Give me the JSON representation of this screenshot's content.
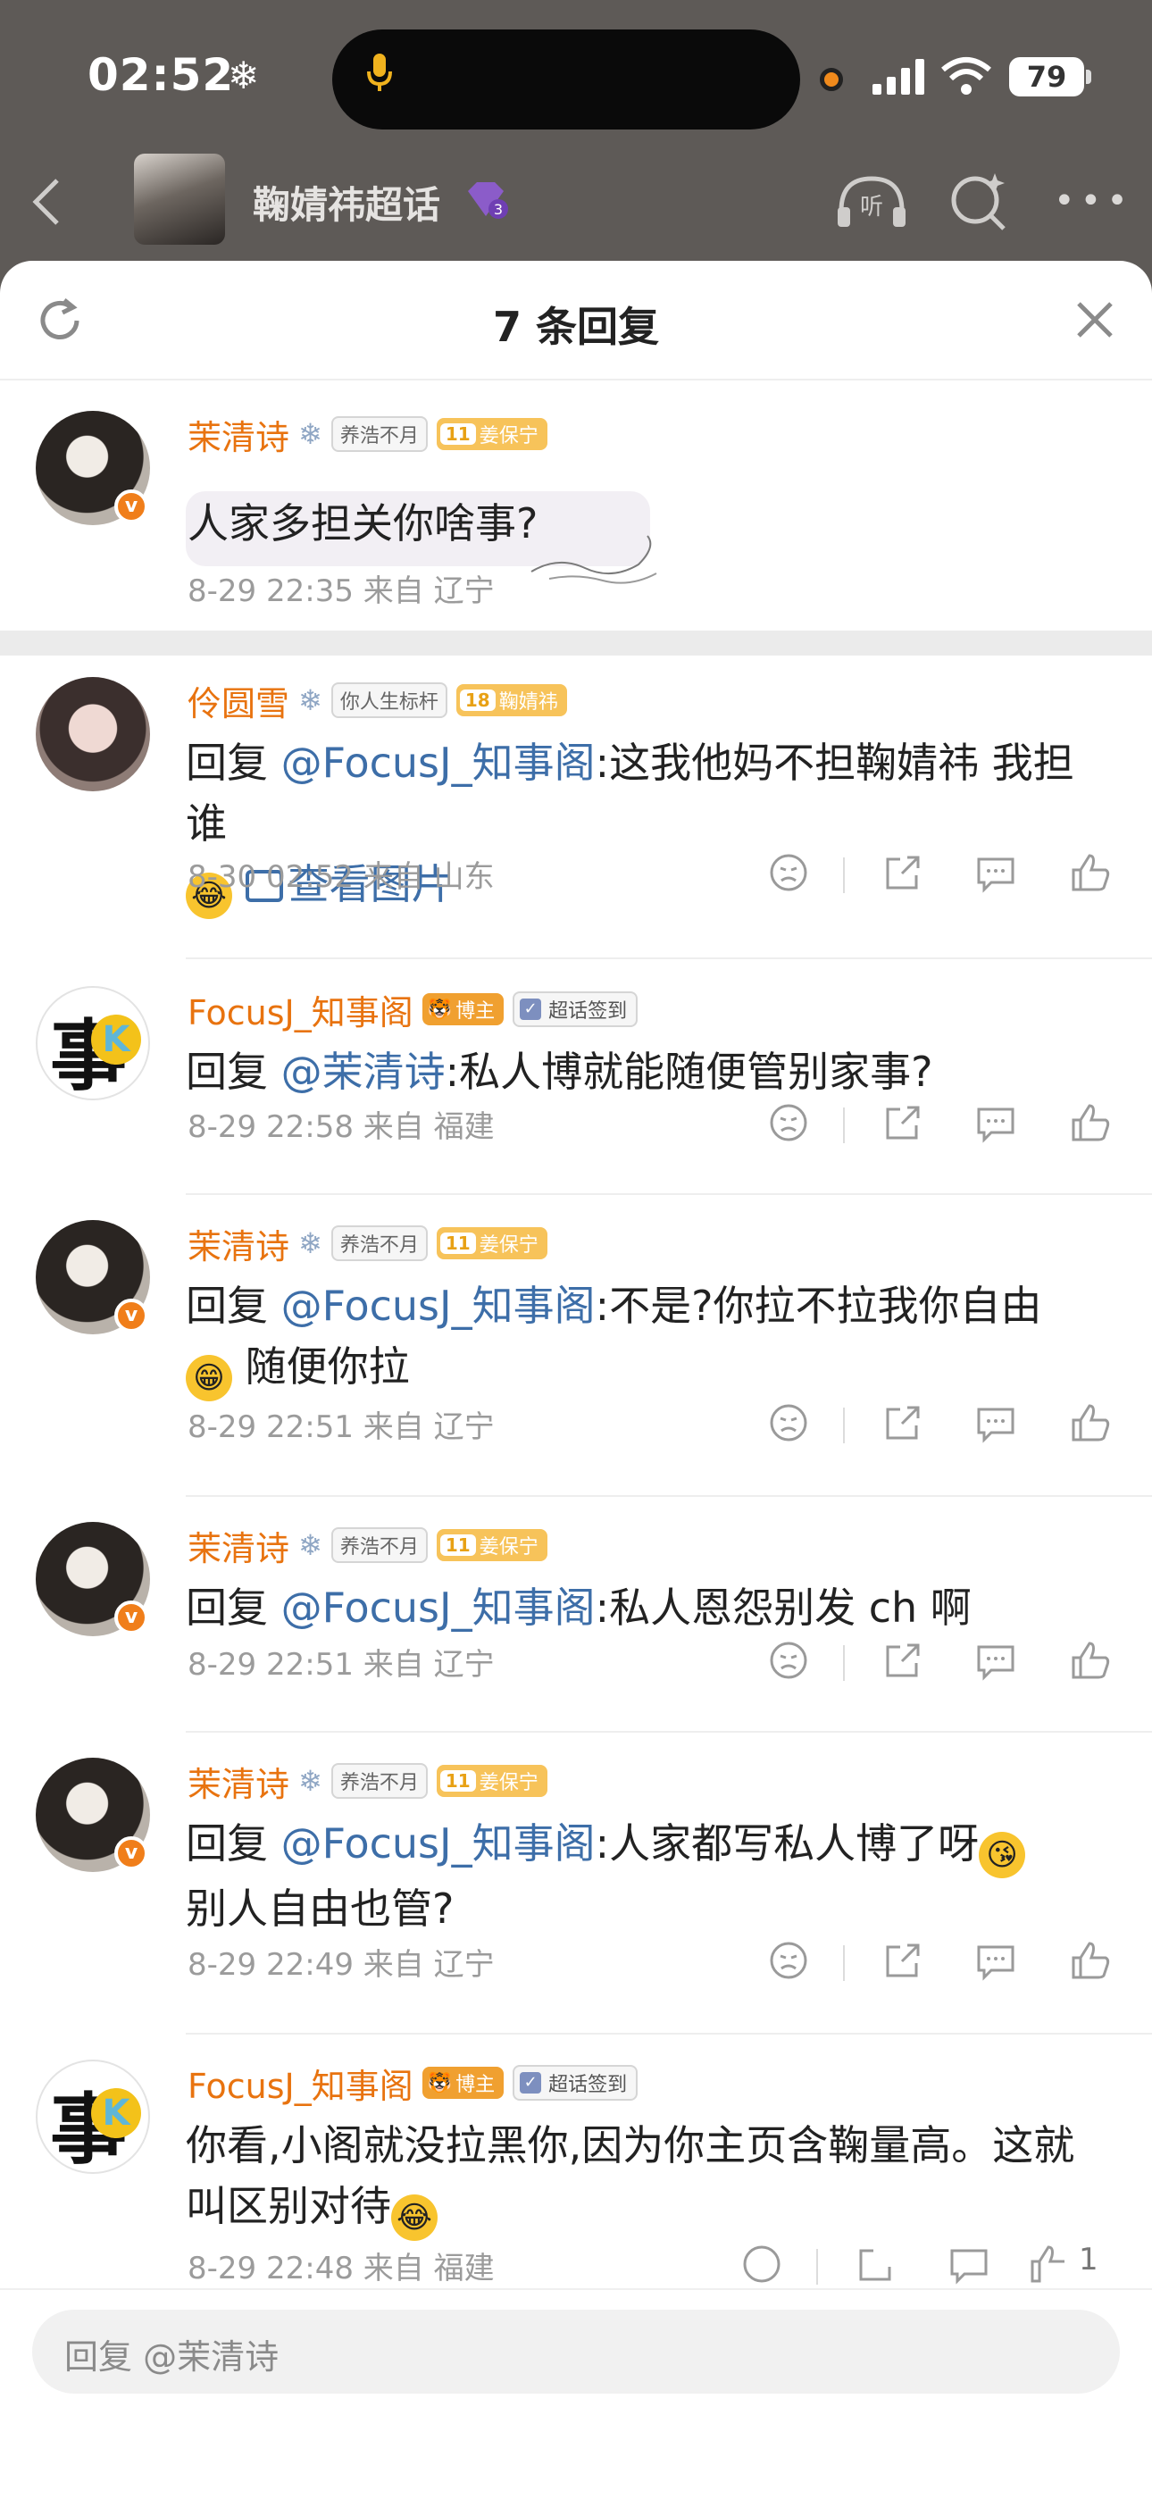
{
  "status_bar": {
    "time": "02:52",
    "battery": "79"
  },
  "nav": {
    "title": "鞠婧祎超话"
  },
  "sheet": {
    "title": "7 条回复"
  },
  "comments": [
    {
      "user": "茉清诗",
      "tag1": "养浩不月",
      "level": "11",
      "tag2": "姜保宁",
      "text": "人家多担关你啥事?",
      "time_loc": "8-29 22:35  来自 辽宁"
    },
    {
      "user": "伶圆雪",
      "tag1": "你人生标杆",
      "level": "18",
      "tag2": "鞠婧祎",
      "reply_prefix": "回复 ",
      "mention": "@FocusJ_知事阁",
      "text": ":这我他妈不担鞠婧祎 我担谁",
      "img_link": "查看图片",
      "time_loc": "8-30 02:52  来自 山东"
    },
    {
      "user": "FocusJ_知事阁",
      "tag_blogger": "博主",
      "tag_checkin": "超话签到",
      "reply_prefix": "回复 ",
      "mention": "@茉清诗",
      "text": ":私人博就能随便管别家事?",
      "time_loc": "8-29 22:58  来自 福建"
    },
    {
      "user": "茉清诗",
      "tag1": "养浩不月",
      "level": "11",
      "tag2": "姜保宁",
      "reply_prefix": "回复 ",
      "mention": "@FocusJ_知事阁",
      "text": ":不是?你拉不拉我你自由",
      "text_after": " 随便你拉",
      "time_loc": "8-29 22:51  来自 辽宁"
    },
    {
      "user": "茉清诗",
      "tag1": "养浩不月",
      "level": "11",
      "tag2": "姜保宁",
      "reply_prefix": "回复 ",
      "mention": "@FocusJ_知事阁",
      "text": ":私人恩怨别发 ch 啊",
      "time_loc": "8-29 22:51  来自 辽宁"
    },
    {
      "user": "茉清诗",
      "tag1": "养浩不月",
      "level": "11",
      "tag2": "姜保宁",
      "reply_prefix": "回复 ",
      "mention": "@FocusJ_知事阁",
      "text": ":人家都写私人博了呀",
      "text_after": "别人自由也管?",
      "time_loc": "8-29 22:49  来自 辽宁"
    },
    {
      "user": "FocusJ_知事阁",
      "tag_blogger": "博主",
      "tag_checkin": "超话签到",
      "text": "你看,小阁就没拉黑你,因为你主页含鞠量高。这就叫区别对待",
      "time_loc": "8-29 22:48  来自 福建",
      "likes": "1"
    }
  ],
  "input": {
    "placeholder": "回复 @茉清诗"
  },
  "icons": [
    "snowflake-icon",
    "microphone-icon",
    "signal-icon",
    "wifi-icon",
    "battery-icon",
    "back-icon",
    "gem-level-icon",
    "listen-icon",
    "ai-search-icon",
    "more-icon",
    "refresh-icon",
    "close-icon",
    "dislike-icon",
    "share-icon",
    "comment-icon",
    "like-icon",
    "image-icon"
  ],
  "colors": {
    "username": "#e8730f",
    "mention": "#3d6ea8",
    "vip_badge": "#f07e1a",
    "sheet_bg": "#ffffff",
    "backdrop": "#5e5a57"
  }
}
